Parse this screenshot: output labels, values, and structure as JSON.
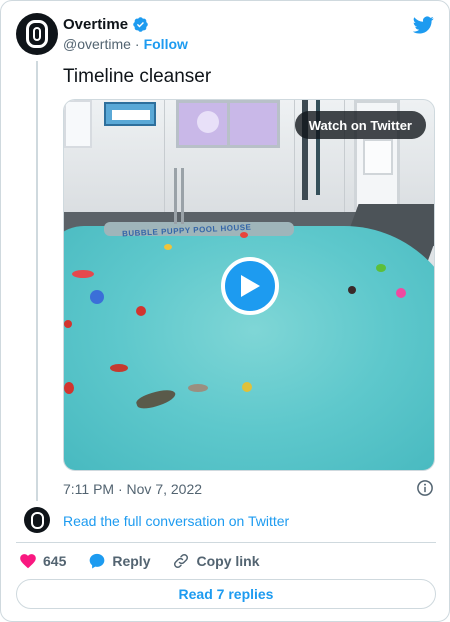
{
  "author": {
    "display_name": "Overtime",
    "handle": "@overtime",
    "separator": "·",
    "follow_label": "Follow"
  },
  "tweet": {
    "text": "Timeline cleanser",
    "timestamp": "7:11 PM · Nov 7, 2022"
  },
  "video": {
    "watch_label": "Watch on Twitter",
    "scene_text": "BUBBLE PUPPY POOL HOUSE"
  },
  "conversation": {
    "read_full_label": "Read the full conversation on Twitter"
  },
  "actions": {
    "like_count": "645",
    "reply_label": "Reply",
    "copy_link_label": "Copy link"
  },
  "footer": {
    "read_replies_label": "Read 7 replies"
  },
  "colors": {
    "accent": "#1d9bf0",
    "like": "#f91880",
    "text": "#0f1419",
    "muted": "#536471"
  },
  "icons": [
    "verified-badge-icon",
    "twitter-logo-icon",
    "play-icon",
    "info-icon",
    "heart-icon",
    "reply-bubble-icon",
    "link-icon"
  ]
}
